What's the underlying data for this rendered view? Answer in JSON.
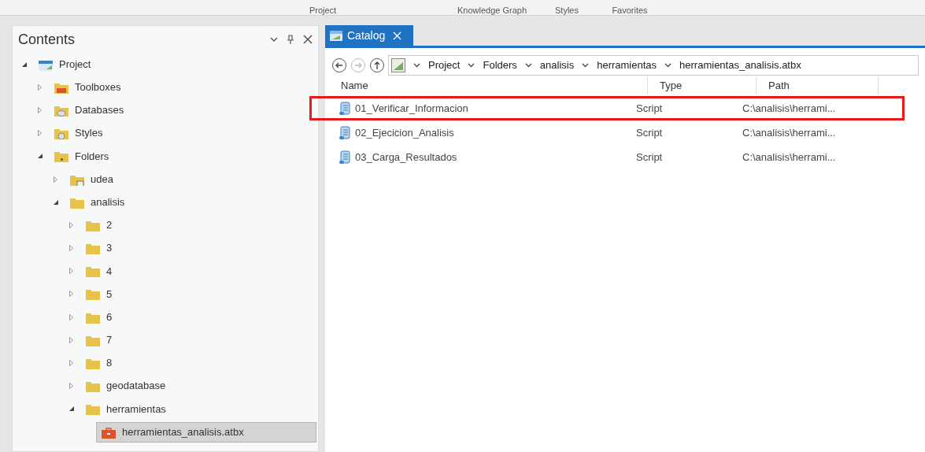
{
  "ribbon_groups": [
    "Project",
    "Knowledge Graph",
    "Styles",
    "Favorites"
  ],
  "contents_pane": {
    "title": "Contents",
    "tree": [
      {
        "label": "Project",
        "kind": "project",
        "expanded": true,
        "selected": false,
        "children": [
          {
            "label": "Toolboxes",
            "kind": "toolboxes",
            "expanded": false,
            "selected": false
          },
          {
            "label": "Databases",
            "kind": "databases",
            "expanded": false,
            "selected": false
          },
          {
            "label": "Styles",
            "kind": "styles",
            "expanded": false,
            "selected": false
          },
          {
            "label": "Folders",
            "kind": "folders",
            "expanded": true,
            "selected": false,
            "children": [
              {
                "label": "udea",
                "kind": "linked-folder",
                "expanded": false,
                "selected": false
              },
              {
                "label": "analisis",
                "kind": "folder",
                "expanded": true,
                "selected": false,
                "children": [
                  {
                    "label": "2",
                    "kind": "folder",
                    "expanded": false,
                    "selected": false
                  },
                  {
                    "label": "3",
                    "kind": "folder",
                    "expanded": false,
                    "selected": false
                  },
                  {
                    "label": "4",
                    "kind": "folder",
                    "expanded": false,
                    "selected": false
                  },
                  {
                    "label": "5",
                    "kind": "folder",
                    "expanded": false,
                    "selected": false
                  },
                  {
                    "label": "6",
                    "kind": "folder",
                    "expanded": false,
                    "selected": false
                  },
                  {
                    "label": "7",
                    "kind": "folder",
                    "expanded": false,
                    "selected": false
                  },
                  {
                    "label": "8",
                    "kind": "folder",
                    "expanded": false,
                    "selected": false
                  },
                  {
                    "label": "geodatabase",
                    "kind": "folder",
                    "expanded": false,
                    "selected": false
                  },
                  {
                    "label": "herramientas",
                    "kind": "folder",
                    "expanded": true,
                    "selected": false,
                    "children": [
                      {
                        "label": "herramientas_analisis.atbx",
                        "kind": "toolbox",
                        "selected": true
                      }
                    ]
                  }
                ]
              }
            ]
          }
        ]
      }
    ]
  },
  "catalog": {
    "tab": {
      "label": "Catalog",
      "selected": true
    },
    "breadcrumb": [
      "Project",
      "Folders",
      "analisis",
      "herramientas",
      "herramientas_analisis.atbx"
    ],
    "columns": [
      "Name",
      "Type",
      "Path"
    ],
    "rows": [
      {
        "name": "01_Verificar_Informacion",
        "type": "Script",
        "path": "C:\\analisis\\herrami...",
        "highlighted": true
      },
      {
        "name": "02_Ejecicion_Analisis",
        "type": "Script",
        "path": "C:\\analisis\\herrami...",
        "highlighted": false
      },
      {
        "name": "03_Carga_Resultados",
        "type": "Script",
        "path": "C:\\analisis\\herrami...",
        "highlighted": false
      }
    ]
  }
}
